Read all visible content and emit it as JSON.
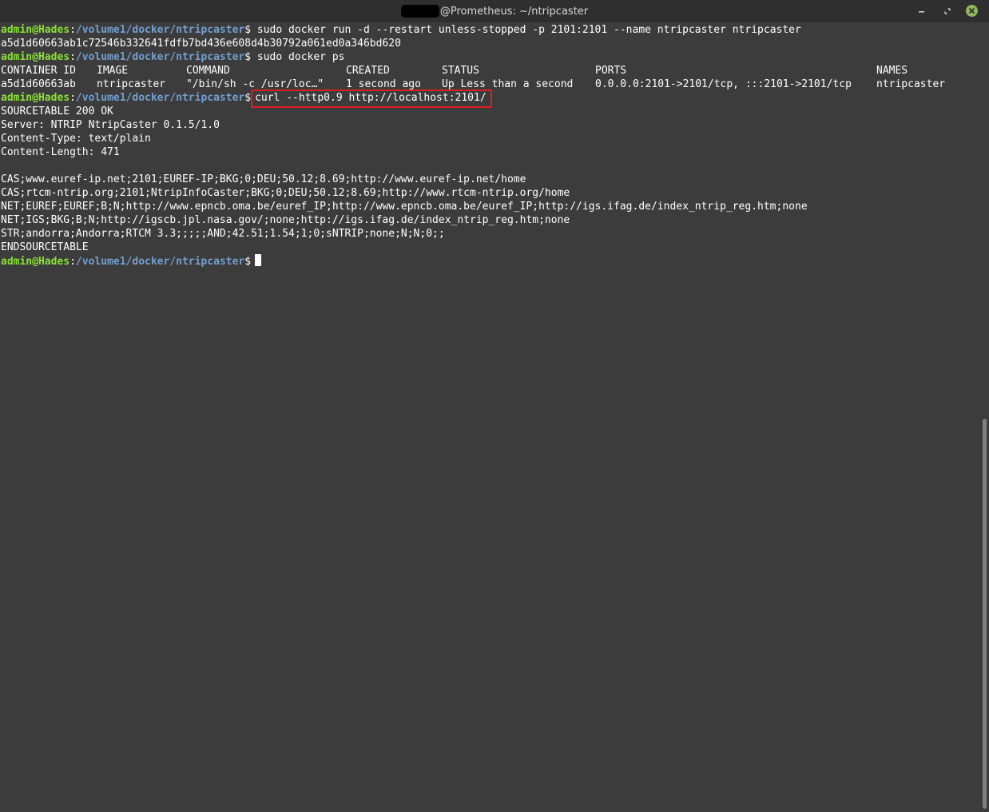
{
  "window": {
    "title": "@Prometheus: ~/ntripcaster"
  },
  "prompt": {
    "user_host": "admin@Hades",
    "sep": ":",
    "path": "/volume1/docker/ntripcaster",
    "symbol": "$"
  },
  "commands": {
    "run": " sudo docker run -d --restart unless-stopped -p 2101:2101 --name ntripcaster ntripcaster",
    "ps": " sudo docker ps",
    "curl": "curl --http0.9 http://localhost:2101/"
  },
  "output": {
    "container_hash": "a5d1d60663ab1c72546b332641fdfb7bd436e608d4b30792a061ed0a346bd620",
    "ps_table": {
      "headers": [
        "CONTAINER ID",
        "IMAGE",
        "COMMAND",
        "CREATED",
        "STATUS",
        "PORTS",
        "NAMES"
      ],
      "rows": [
        [
          "a5d1d60663ab",
          "ntripcaster",
          "\"/bin/sh -c /usr/loc…\"",
          "1 second ago",
          "Up Less than a second",
          "0.0.0.0:2101->2101/tcp, :::2101->2101/tcp",
          "ntripcaster"
        ]
      ]
    },
    "curl_lines": [
      "SOURCETABLE 200 OK",
      "Server: NTRIP NtripCaster 0.1.5/1.0",
      "Content-Type: text/plain",
      "Content-Length: 471",
      "",
      "CAS;www.euref-ip.net;2101;EUREF-IP;BKG;0;DEU;50.12;8.69;http://www.euref-ip.net/home",
      "CAS;rtcm-ntrip.org;2101;NtripInfoCaster;BKG;0;DEU;50.12;8.69;http://www.rtcm-ntrip.org/home",
      "NET;EUREF;EUREF;B;N;http://www.epncb.oma.be/euref_IP;http://www.epncb.oma.be/euref_IP;http://igs.ifag.de/index_ntrip_reg.htm;none",
      "NET;IGS;BKG;B;N;http://igscb.jpl.nasa.gov/;none;http://igs.ifag.de/index_ntrip_reg.htm;none",
      "STR;andorra;Andorra;RTCM 3.3;;;;;AND;42.51;1.54;1;0;sNTRIP;none;N;N;0;;",
      "ENDSOURCETABLE"
    ]
  },
  "icons": {
    "minimize": "minimize-icon",
    "restore": "restore-icon",
    "close": "close-icon"
  },
  "colors": {
    "background": "#3c3c3c",
    "prompt_user": "#8ae234",
    "prompt_path": "#729fcf",
    "highlight_box": "#e01b24",
    "close_button": "#8fb65a"
  }
}
